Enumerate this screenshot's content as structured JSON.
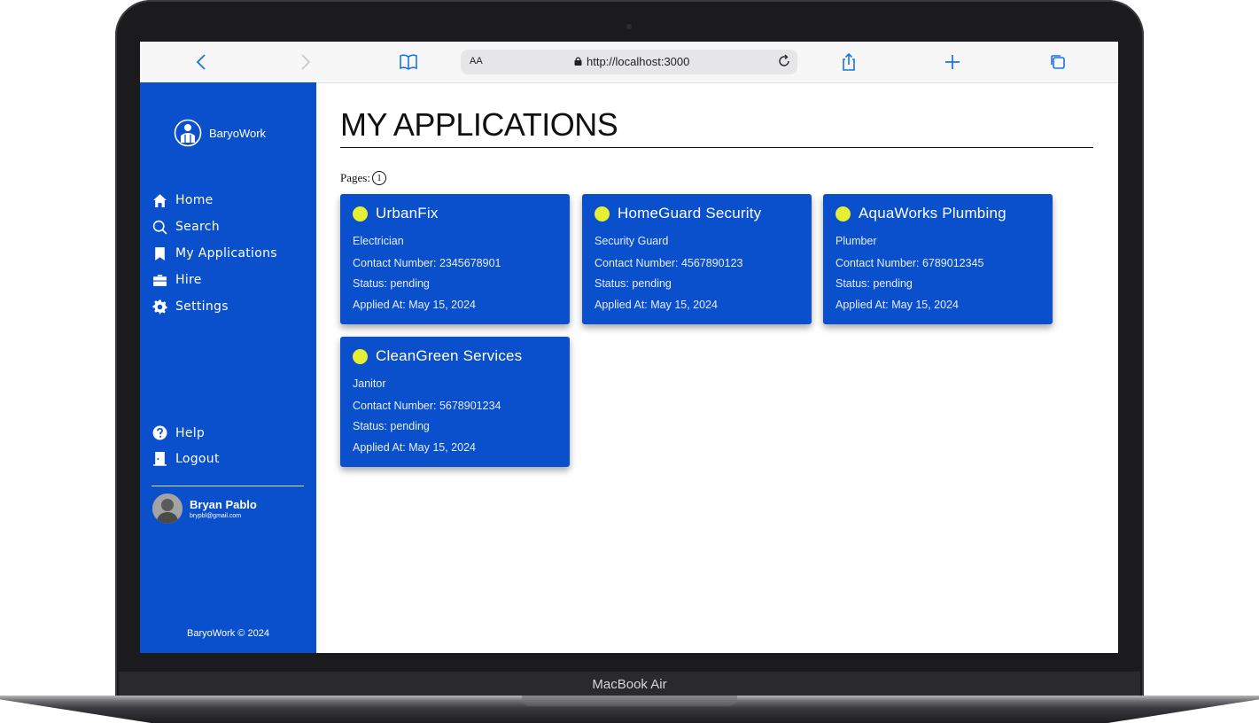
{
  "device": {
    "label": "MacBook Air"
  },
  "browser": {
    "text_size_label": "AA",
    "url": "http://localhost:3000"
  },
  "sidebar": {
    "brand": "BaryoWork",
    "nav": [
      {
        "label": "Home",
        "icon": "home-icon"
      },
      {
        "label": "Search",
        "icon": "search-icon"
      },
      {
        "label": "My Applications",
        "icon": "bookmark-icon"
      },
      {
        "label": "Hire",
        "icon": "briefcase-icon"
      },
      {
        "label": "Settings",
        "icon": "gear-icon"
      }
    ],
    "nav_bottom": [
      {
        "label": "Help",
        "icon": "help-icon"
      },
      {
        "label": "Logout",
        "icon": "door-icon"
      }
    ],
    "user": {
      "name": "Bryan Pablo",
      "email": "brypbl@gmail.com"
    },
    "footer": "BaryoWork © 2024"
  },
  "main": {
    "title": "MY APPLICATIONS",
    "pages_label": "Pages:",
    "pages": [
      "1"
    ]
  },
  "applications": [
    {
      "company": "UrbanFix",
      "role": "Electrician",
      "contact": "Contact Number: 2345678901",
      "status": "Status: pending",
      "applied": "Applied At: May 15, 2024"
    },
    {
      "company": "HomeGuard Security",
      "role": "Security Guard",
      "contact": "Contact Number: 4567890123",
      "status": "Status: pending",
      "applied": "Applied At: May 15, 2024"
    },
    {
      "company": "AquaWorks Plumbing",
      "role": "Plumber",
      "contact": "Contact Number: 6789012345",
      "status": "Status: pending",
      "applied": "Applied At: May 15, 2024"
    },
    {
      "company": "CleanGreen Services",
      "role": "Janitor",
      "contact": "Contact Number: 5678901234",
      "status": "Status: pending",
      "applied": "Applied At: May 15, 2024"
    }
  ],
  "colors": {
    "primary": "#0a4fcc",
    "status_dot": "#e7ef35",
    "browser_accent": "#1a73e8"
  }
}
